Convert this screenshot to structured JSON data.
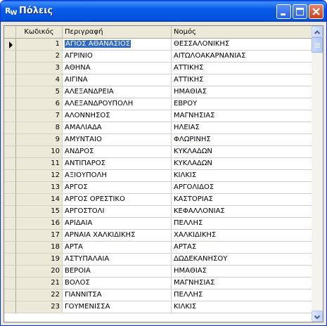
{
  "window": {
    "title": "Πόλεις",
    "icon_text": "R",
    "icon_sub": "W"
  },
  "grid": {
    "columns": {
      "code": "Κωδικός",
      "description": "Περιγραφή",
      "nomos": "Νομός"
    },
    "selected_row": 0,
    "rows": [
      {
        "code": "1",
        "description": "ΑΓΙΟΣ ΑΘΑΝΑΣΙΟΣ",
        "nomos": "ΘΕΣΣΑΛΟΝΙΚΗΣ"
      },
      {
        "code": "2",
        "description": "ΑΓΡΙΝΙΟ",
        "nomos": "ΑΙΤΩΛΟΑΚΑΡΝΑΝΙΑΣ"
      },
      {
        "code": "3",
        "description": "ΑΘΗΝΑ",
        "nomos": "ΑΤΤΙΚΗΣ"
      },
      {
        "code": "4",
        "description": "ΑΙΓΙΝΑ",
        "nomos": "ΑΤΤΙΚΗΣ"
      },
      {
        "code": "5",
        "description": "ΑΛΕΞΑΝΔΡΕΙΑ",
        "nomos": "ΗΜΑΘΙΑΣ"
      },
      {
        "code": "6",
        "description": "ΑΛΕΞΑΝΔΡΟΥΠΟΛΗ",
        "nomos": "ΕΒΡΟΥ"
      },
      {
        "code": "7",
        "description": "ΑΛΟΝΝΗΣΟΣ",
        "nomos": "ΜΑΓΝΗΣΙΑΣ"
      },
      {
        "code": "8",
        "description": "ΑΜΑΛΙΑΔΑ",
        "nomos": "ΗΛΕΙΑΣ"
      },
      {
        "code": "9",
        "description": "ΑΜΥΝΤΑΙΟ",
        "nomos": "ΦΛΩΡΙΝΗΣ"
      },
      {
        "code": "10",
        "description": "ΑΝΔΡΟΣ",
        "nomos": "ΚΥΚΛΑΔΩΝ"
      },
      {
        "code": "11",
        "description": "ΑΝΤΙΠΑΡΟΣ",
        "nomos": "ΚΥΚΛΑΔΩΝ"
      },
      {
        "code": "12",
        "description": "ΑΞΙΟΥΠΟΛΗ",
        "nomos": "ΚΙΛΚΙΣ"
      },
      {
        "code": "13",
        "description": "ΑΡΓΟΣ",
        "nomos": "ΑΡΓΟΛΙΔΟΣ"
      },
      {
        "code": "14",
        "description": "ΑΡΓΟΣ ΟΡΕΣΤΙΚΟ",
        "nomos": "ΚΑΣΤΟΡΙΑΣ"
      },
      {
        "code": "15",
        "description": "ΑΡΓΟΣΤΟΛΙ",
        "nomos": "ΚΕΦΑΛΛΟΝΙΑΣ"
      },
      {
        "code": "16",
        "description": "ΑΡΙΔΑΙΑ",
        "nomos": "ΠΕΛΛΗΣ"
      },
      {
        "code": "17",
        "description": "ΑΡΝΑΙΑ ΧΑΛΚΙΔΙΚΗΣ",
        "nomos": "ΧΑΛΚΙΔΙΚΗΣ"
      },
      {
        "code": "18",
        "description": "ΑΡΤΑ",
        "nomos": "ΑΡΤΑΣ"
      },
      {
        "code": "19",
        "description": "ΑΣΤΥΠΑΛΑΙΑ",
        "nomos": "ΔΩΔΕΚΑΝΗΣΟΥ"
      },
      {
        "code": "20",
        "description": "ΒΕΡΟΙΑ",
        "nomos": "ΗΜΑΘΙΑΣ"
      },
      {
        "code": "21",
        "description": "ΒΟΛΟΣ",
        "nomos": "ΜΑΓΝΗΣΙΑΣ"
      },
      {
        "code": "22",
        "description": "ΓΙΑΝΝΙΤΣΑ",
        "nomos": "ΠΕΛΛΗΣ"
      },
      {
        "code": "23",
        "description": "ΓΟΥΜΕΝΙΣΣΑ",
        "nomos": "ΚΙΛΚΙΣ"
      }
    ]
  },
  "colors": {
    "selection": "#316ac5",
    "titlebar": "#0053e0",
    "close_button": "#c9411f"
  },
  "icons": {
    "minimize": "minimize-icon",
    "maximize": "maximize-icon",
    "close": "close-icon",
    "row_indicator": "row-indicator-arrow-icon",
    "scroll_up": "scroll-up-icon",
    "scroll_down": "scroll-down-icon"
  }
}
